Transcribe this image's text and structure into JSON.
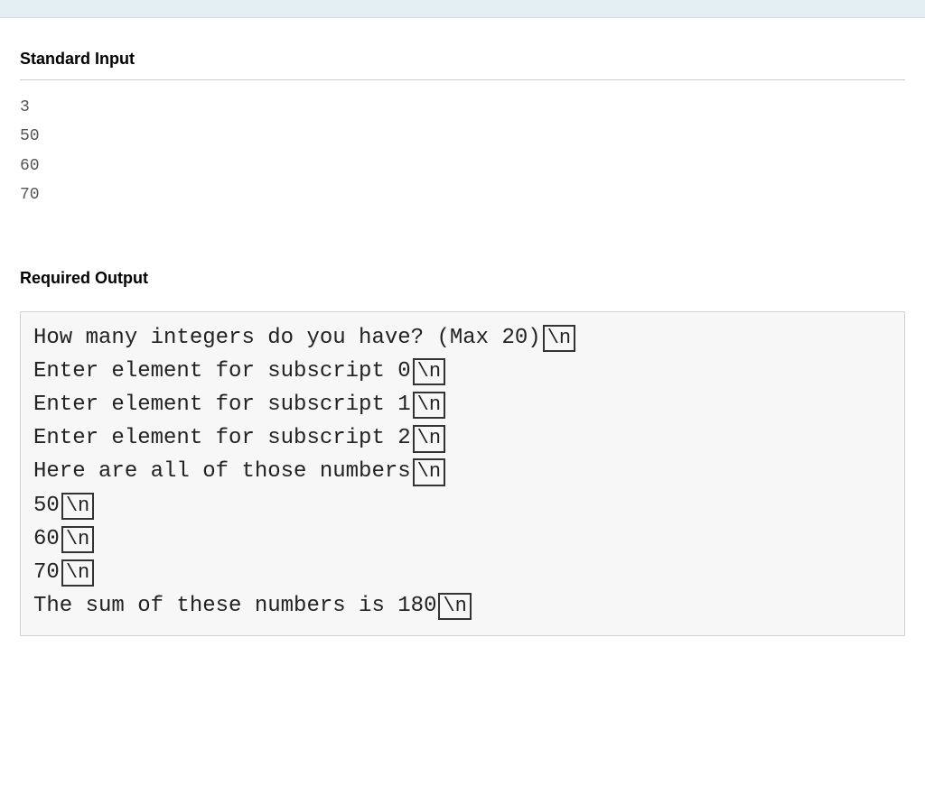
{
  "sections": {
    "standardInput": {
      "title": "Standard Input",
      "lines": [
        "3",
        "50",
        "60",
        "70"
      ]
    },
    "requiredOutput": {
      "title": "Required Output",
      "lines": [
        {
          "text": "How many integers do you have? (Max 20)",
          "newline": "\\n"
        },
        {
          "text": "Enter element for subscript 0",
          "newline": "\\n"
        },
        {
          "text": "Enter element for subscript 1",
          "newline": "\\n"
        },
        {
          "text": "Enter element for subscript 2",
          "newline": "\\n"
        },
        {
          "text": "Here are all of those numbers",
          "newline": "\\n"
        },
        {
          "text": "50",
          "newline": "\\n"
        },
        {
          "text": "60",
          "newline": "\\n"
        },
        {
          "text": "70",
          "newline": "\\n"
        },
        {
          "text": "The sum of these numbers is 180",
          "newline": "\\n"
        }
      ]
    }
  }
}
